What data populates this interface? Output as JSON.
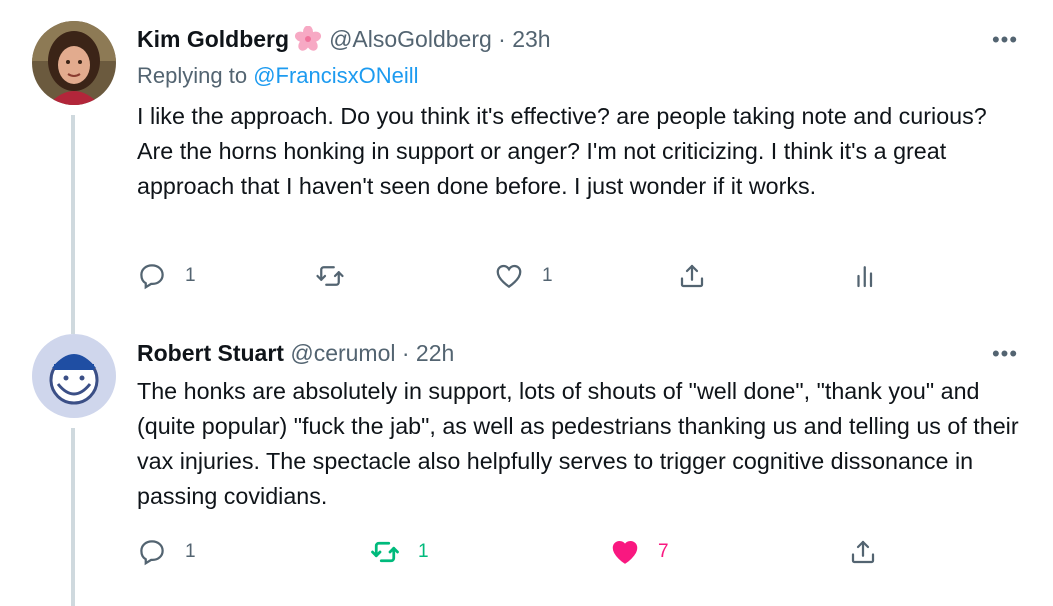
{
  "tweets": [
    {
      "author_name": "Kim Goldberg",
      "author_emoji": "cherry-blossom",
      "handle_time": "@AlsoGoldberg · 23h",
      "replying_prefix": "Replying to",
      "replying_handle": "@FrancisxONeill",
      "text": "I like the approach. Do you think it's effective? are people taking note and curious? Are the horns honking in support or anger? I'm not criticizing. I think it's a great approach that I haven't seen done before. I just wonder if it works.",
      "reply_count": "1",
      "retweet_count": "",
      "like_count": "1",
      "more_label": "•••"
    },
    {
      "author_name": "Robert Stuart",
      "handle_time": "@cerumol · 22h",
      "text": "The honks are absolutely in support, lots of shouts of \"well done\", \"thank you\" and (quite popular) \"fuck the jab\", as well as pedestrians thanking us and telling us of their vax injuries. The spectacle also helpfully serves to trigger cognitive dissonance in passing covidians.",
      "reply_count": "1",
      "retweet_count": "1",
      "like_count": "7",
      "more_label": "•••"
    }
  ],
  "colors": {
    "text": "#0f1419",
    "secondary": "#536471",
    "link": "#1d9bf0",
    "retweet_active": "#00ba7c",
    "like_active": "#f91880",
    "thread_line": "#cfd9de"
  }
}
